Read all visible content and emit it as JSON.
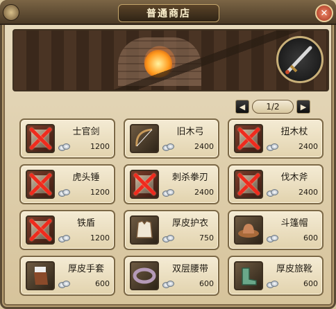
{
  "window": {
    "title": "普通商店",
    "close_label": "✕"
  },
  "pager": {
    "prev_label": "◀",
    "next_label": "▶",
    "current": "1/2"
  },
  "currency_icon": "silver-coin-icon",
  "items": [
    {
      "name": "士官剑",
      "price": "1200",
      "icon": "sword-icon",
      "locked": true
    },
    {
      "name": "旧木弓",
      "price": "2400",
      "icon": "bow-icon",
      "locked": false
    },
    {
      "name": "扭木杖",
      "price": "2400",
      "icon": "staff-icon",
      "locked": true
    },
    {
      "name": "虎头锤",
      "price": "1200",
      "icon": "hammer-icon",
      "locked": true
    },
    {
      "name": "刺杀拳刃",
      "price": "2400",
      "icon": "fist-blade-icon",
      "locked": true
    },
    {
      "name": "伐木斧",
      "price": "2400",
      "icon": "axe-icon",
      "locked": true
    },
    {
      "name": "铁盾",
      "price": "1200",
      "icon": "shield-icon",
      "locked": true
    },
    {
      "name": "厚皮护衣",
      "price": "750",
      "icon": "armor-icon",
      "locked": false
    },
    {
      "name": "斗篷帽",
      "price": "600",
      "icon": "hat-icon",
      "locked": false
    },
    {
      "name": "厚皮手套",
      "price": "600",
      "icon": "glove-icon",
      "locked": false
    },
    {
      "name": "双层腰带",
      "price": "600",
      "icon": "belt-icon",
      "locked": false
    },
    {
      "name": "厚皮旅靴",
      "price": "600",
      "icon": "boots-icon",
      "locked": false
    }
  ],
  "colors": {
    "frame": "#5a4a34",
    "slot_bg": "#f4ebd4",
    "forbidden": "#ef2b1e"
  }
}
